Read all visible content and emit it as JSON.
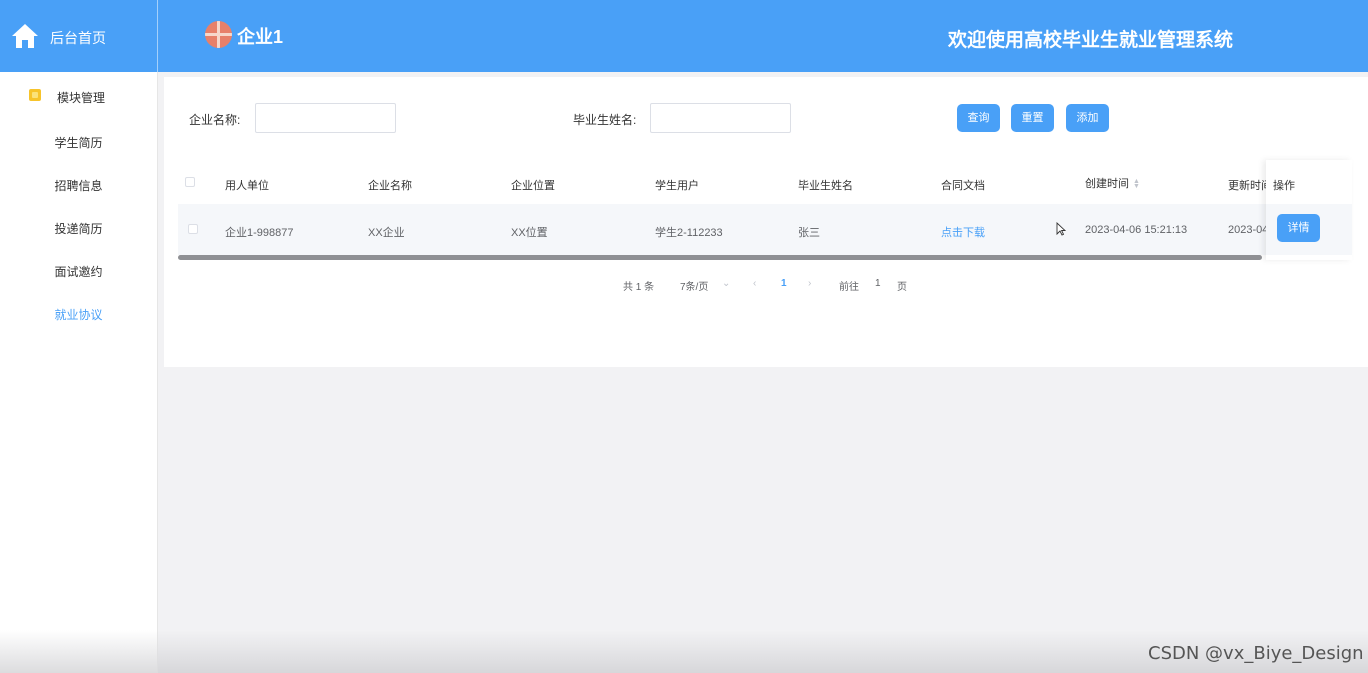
{
  "header": {
    "home_label": "后台首页",
    "user_name": "企业1",
    "system_title": "欢迎使用高校毕业生就业管理系统"
  },
  "sidebar": {
    "group_label": "模块管理",
    "items": [
      {
        "label": "学生简历"
      },
      {
        "label": "招聘信息"
      },
      {
        "label": "投递简历"
      },
      {
        "label": "面试邀约"
      },
      {
        "label": "就业协议"
      }
    ],
    "active_index": 4
  },
  "filters": {
    "company_label": "企业名称:",
    "company_value": "",
    "graduate_label": "毕业生姓名:",
    "graduate_value": "",
    "query_button": "查询",
    "reset_button": "重置",
    "add_button": "添加"
  },
  "table": {
    "headers": {
      "employer": "用人单位",
      "company_name": "企业名称",
      "company_location": "企业位置",
      "student_user": "学生用户",
      "graduate_name": "毕业生姓名",
      "contract_doc": "合同文档",
      "created_time": "创建时间",
      "updated_time": "更新时间",
      "actions": "操作"
    },
    "rows": [
      {
        "employer": "企业1-998877",
        "company_name": "XX企业",
        "company_location": "XX位置",
        "student_user": "学生2-112233",
        "graduate_name": "张三",
        "contract_doc": "点击下载",
        "created_time": "2023-04-06 15:21:13",
        "updated_time": "2023-04",
        "detail_button": "详情"
      }
    ]
  },
  "pagination": {
    "total": "共 1 条",
    "page_size": "7条/页",
    "current_page": "1",
    "goto_prefix": "前往",
    "goto_value": "1",
    "goto_suffix": "页"
  },
  "watermark": "CSDN @vx_Biye_Design",
  "colors": {
    "primary": "#49a0f7",
    "background": "#f2f2f4"
  }
}
